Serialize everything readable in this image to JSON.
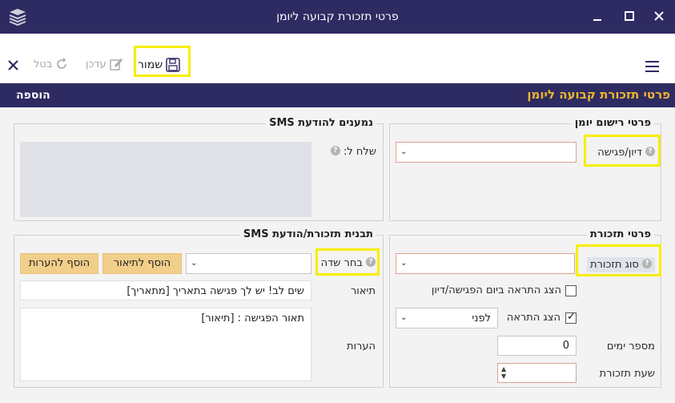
{
  "window": {
    "title": "פרטי תזכורת קבועה ליומן"
  },
  "toolbar": {
    "save_label": "שמור",
    "update_label": "עדכן",
    "cancel_label": "בטל"
  },
  "header": {
    "title": "פרטי תזכורת קבועה ליומן",
    "mode": "הוספה"
  },
  "diary_panel": {
    "legend": "פרטי רישום יומן",
    "meeting_label": "דיון/פגישה",
    "meeting_value": ""
  },
  "sms_recipients_panel": {
    "legend": "נמענים להודעת SMS",
    "send_to_label": "שלח ל:"
  },
  "reminder_panel": {
    "legend": "פרטי תזכורת",
    "type_label": "סוג תזכורת",
    "type_value": "",
    "show_on_day_label": "הצג התראה ביום הפגישה/דיון",
    "show_on_day_checked": false,
    "show_alert_label": "הצג התראה",
    "show_alert_checked": true,
    "before_after_value": "לפני",
    "days_label": "מספר ימים",
    "days_value": "0",
    "time_label": "שעת תזכורת",
    "time_value": ""
  },
  "template_panel": {
    "legend": "תבנית תזכורת/הודעת SMS",
    "choose_field_label": "בחר שדה",
    "choose_field_value": "",
    "add_to_description_label": "הוסף לתיאור",
    "add_to_notes_label": "הוסף להערות",
    "description_label": "תיאור",
    "description_value": "שים לב! יש לך פגישה בתאריך [מתאריך]",
    "notes_label": "הערות",
    "notes_value": "תאור הפגישה : [תיאור]"
  },
  "colors": {
    "primary": "#2e2b62",
    "accent_title": "#f1b62f",
    "highlight": "#f6ee00",
    "button": "#f1cf8b"
  }
}
